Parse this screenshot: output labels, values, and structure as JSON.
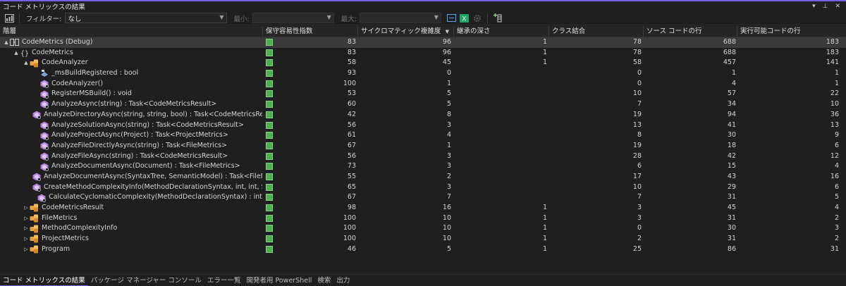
{
  "window": {
    "title": "コード メトリックスの結果",
    "pin_glyph": "▾",
    "pin2_glyph": "⊥",
    "close_glyph": "✕"
  },
  "toolbar": {
    "filter_label": "フィルター:",
    "filter_value": "なし",
    "min_label": "最小:",
    "min_value": "",
    "max_label": "最大:",
    "max_value": ""
  },
  "columns": {
    "hierarchy": "階層",
    "mi": "保守容易性指数",
    "cc": "サイクロマティック複雑度",
    "depth": "継承の深さ",
    "coupling": "クラス結合",
    "sloc": "ソース コードの行",
    "eloc": "実行可能コードの行"
  },
  "colors": {
    "accent": "#7160e8",
    "mi_green": "#4caf50",
    "selected_row": "#3a3a3a",
    "class_icon": "#e8a33a",
    "method_icon": "#b180d7"
  },
  "rows": [
    {
      "indent": 0,
      "expander": "▲",
      "icon": "project-icon",
      "name": "CodeMetrics (Debug)",
      "mi": "83",
      "cc": "96",
      "depth": "1",
      "coupling": "78",
      "sloc": "688",
      "eloc": "183",
      "selected": true
    },
    {
      "indent": 1,
      "expander": "▲",
      "icon": "namespace-icon",
      "name": "CodeMetrics",
      "mi": "83",
      "cc": "96",
      "depth": "1",
      "coupling": "78",
      "sloc": "688",
      "eloc": "183"
    },
    {
      "indent": 2,
      "expander": "▲",
      "icon": "class-icon",
      "name": "CodeAnalyzer",
      "mi": "58",
      "cc": "45",
      "depth": "1",
      "coupling": "58",
      "sloc": "457",
      "eloc": "141"
    },
    {
      "indent": 3,
      "expander": "",
      "icon": "field-icon",
      "name": "_msBuildRegistered : bool",
      "mi": "93",
      "cc": "0",
      "depth": "",
      "coupling": "0",
      "sloc": "1",
      "eloc": "1"
    },
    {
      "indent": 3,
      "expander": "",
      "icon": "method-icon",
      "name": "CodeAnalyzer()",
      "mi": "100",
      "cc": "1",
      "depth": "",
      "coupling": "0",
      "sloc": "4",
      "eloc": "1"
    },
    {
      "indent": 3,
      "expander": "",
      "icon": "method-icon",
      "name": "RegisterMSBuild() : void",
      "mi": "53",
      "cc": "5",
      "depth": "",
      "coupling": "10",
      "sloc": "57",
      "eloc": "22"
    },
    {
      "indent": 3,
      "expander": "",
      "icon": "method-icon",
      "name": "AnalyzeAsync(string) : Task<CodeMetricsResult>",
      "mi": "60",
      "cc": "5",
      "depth": "",
      "coupling": "7",
      "sloc": "34",
      "eloc": "10"
    },
    {
      "indent": 3,
      "expander": "",
      "icon": "method-icon",
      "name": "AnalyzeDirectoryAsync(string, string, bool) : Task<CodeMetricsResult>",
      "mi": "42",
      "cc": "8",
      "depth": "",
      "coupling": "19",
      "sloc": "94",
      "eloc": "36"
    },
    {
      "indent": 3,
      "expander": "",
      "icon": "method-icon",
      "name": "AnalyzeSolutionAsync(string) : Task<CodeMetricsResult>",
      "mi": "56",
      "cc": "3",
      "depth": "",
      "coupling": "13",
      "sloc": "41",
      "eloc": "13"
    },
    {
      "indent": 3,
      "expander": "",
      "icon": "method-icon",
      "name": "AnalyzeProjectAsync(Project) : Task<ProjectMetrics>",
      "mi": "61",
      "cc": "4",
      "depth": "",
      "coupling": "8",
      "sloc": "30",
      "eloc": "9"
    },
    {
      "indent": 3,
      "expander": "",
      "icon": "method-icon",
      "name": "AnalyzeFileDirectlyAsync(string) : Task<FileMetrics>",
      "mi": "67",
      "cc": "1",
      "depth": "",
      "coupling": "19",
      "sloc": "18",
      "eloc": "6"
    },
    {
      "indent": 3,
      "expander": "",
      "icon": "method-icon",
      "name": "AnalyzeFileAsync(string) : Task<CodeMetricsResult>",
      "mi": "56",
      "cc": "3",
      "depth": "",
      "coupling": "28",
      "sloc": "42",
      "eloc": "12"
    },
    {
      "indent": 3,
      "expander": "",
      "icon": "method-icon",
      "name": "AnalyzeDocumentAsync(Document) : Task<FileMetrics>",
      "mi": "73",
      "cc": "3",
      "depth": "",
      "coupling": "6",
      "sloc": "15",
      "eloc": "4"
    },
    {
      "indent": 3,
      "expander": "",
      "icon": "method-icon",
      "name": "AnalyzeDocumentAsync(SyntaxTree, SemanticModel) : Task<FileMetrics>",
      "mi": "55",
      "cc": "2",
      "depth": "",
      "coupling": "17",
      "sloc": "43",
      "eloc": "16"
    },
    {
      "indent": 3,
      "expander": "",
      "icon": "method-icon",
      "name": "CreateMethodComplexityInfo(MethodDeclarationSyntax, int, int, SyntaxTr",
      "mi": "65",
      "cc": "3",
      "depth": "",
      "coupling": "10",
      "sloc": "29",
      "eloc": "6"
    },
    {
      "indent": 3,
      "expander": "",
      "icon": "method-icon",
      "name": "CalculateCyclomaticComplexity(MethodDeclarationSyntax) : int",
      "mi": "67",
      "cc": "7",
      "depth": "",
      "coupling": "7",
      "sloc": "31",
      "eloc": "5"
    },
    {
      "indent": 2,
      "expander": "▷",
      "icon": "class-icon",
      "name": "CodeMetricsResult",
      "mi": "98",
      "cc": "16",
      "depth": "1",
      "coupling": "3",
      "sloc": "45",
      "eloc": "4"
    },
    {
      "indent": 2,
      "expander": "▷",
      "icon": "class-icon",
      "name": "FileMetrics",
      "mi": "100",
      "cc": "10",
      "depth": "1",
      "coupling": "3",
      "sloc": "31",
      "eloc": "2"
    },
    {
      "indent": 2,
      "expander": "▷",
      "icon": "class-icon",
      "name": "MethodComplexityInfo",
      "mi": "100",
      "cc": "10",
      "depth": "1",
      "coupling": "0",
      "sloc": "30",
      "eloc": "3"
    },
    {
      "indent": 2,
      "expander": "▷",
      "icon": "class-icon",
      "name": "ProjectMetrics",
      "mi": "100",
      "cc": "10",
      "depth": "1",
      "coupling": "2",
      "sloc": "31",
      "eloc": "2"
    },
    {
      "indent": 2,
      "expander": "▷",
      "icon": "class-icon",
      "name": "Program",
      "mi": "46",
      "cc": "5",
      "depth": "1",
      "coupling": "25",
      "sloc": "86",
      "eloc": "31"
    }
  ],
  "bottom_tabs": [
    {
      "label": "コード メトリックスの結果",
      "active": true
    },
    {
      "label": "パッケージ マネージャー コンソール"
    },
    {
      "label": "エラー一覧"
    },
    {
      "label": "開発者用 PowerShell"
    },
    {
      "label": "検索"
    },
    {
      "label": "出力"
    }
  ]
}
